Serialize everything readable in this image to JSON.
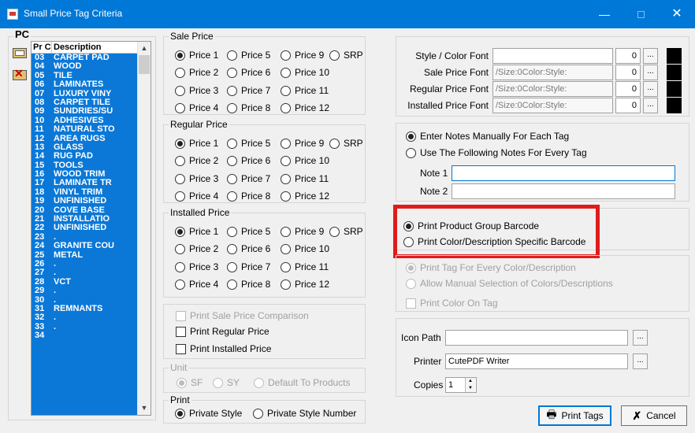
{
  "window": {
    "title": "Small Price Tag Criteria",
    "minimize": "—",
    "maximize": "",
    "close": "✕"
  },
  "pc_panel": {
    "label": "PC",
    "columns": [
      "Pr C",
      "Description"
    ],
    "rows": [
      {
        "pc": "03",
        "desc": "CARPET PAD"
      },
      {
        "pc": "04",
        "desc": "WOOD"
      },
      {
        "pc": "05",
        "desc": "TILE"
      },
      {
        "pc": "06",
        "desc": "LAMINATES"
      },
      {
        "pc": "07",
        "desc": "LUXURY VINY"
      },
      {
        "pc": "08",
        "desc": "CARPET TILE"
      },
      {
        "pc": "09",
        "desc": "SUNDRIES/SU"
      },
      {
        "pc": "10",
        "desc": "ADHESIVES"
      },
      {
        "pc": "11",
        "desc": "NATURAL STO"
      },
      {
        "pc": "12",
        "desc": "AREA RUGS"
      },
      {
        "pc": "13",
        "desc": "GLASS"
      },
      {
        "pc": "14",
        "desc": "RUG PAD"
      },
      {
        "pc": "15",
        "desc": "TOOLS"
      },
      {
        "pc": "16",
        "desc": "WOOD TRIM"
      },
      {
        "pc": "17",
        "desc": "LAMINATE TR"
      },
      {
        "pc": "18",
        "desc": "VINYL TRIM"
      },
      {
        "pc": "19",
        "desc": "UNFINISHED"
      },
      {
        "pc": "20",
        "desc": "COVE BASE"
      },
      {
        "pc": "21",
        "desc": "INSTALLATIO"
      },
      {
        "pc": "22",
        "desc": "UNFINISHED"
      },
      {
        "pc": "23",
        "desc": "."
      },
      {
        "pc": "24",
        "desc": "GRANITE COU"
      },
      {
        "pc": "25",
        "desc": "METAL"
      },
      {
        "pc": "26",
        "desc": "."
      },
      {
        "pc": "27",
        "desc": "."
      },
      {
        "pc": "28",
        "desc": "VCT"
      },
      {
        "pc": "29",
        "desc": "."
      },
      {
        "pc": "30",
        "desc": "."
      },
      {
        "pc": "31",
        "desc": "REMNANTS"
      },
      {
        "pc": "32",
        "desc": "."
      },
      {
        "pc": "33",
        "desc": "."
      },
      {
        "pc": "34",
        "desc": ""
      }
    ]
  },
  "sale_price": {
    "label": "Sale Price",
    "options": [
      "Price 1",
      "Price 5",
      "Price 9",
      "SRP",
      "Price 2",
      "Price 6",
      "Price 10",
      "Price 3",
      "Price 7",
      "Price 11",
      "Price 4",
      "Price 8",
      "Price 12"
    ],
    "selected": "Price 1"
  },
  "regular_price": {
    "label": "Regular Price",
    "options": [
      "Price 1",
      "Price 5",
      "Price 9",
      "SRP",
      "Price 2",
      "Price 6",
      "Price 10",
      "Price 3",
      "Price 7",
      "Price 11",
      "Price 4",
      "Price 8",
      "Price 12"
    ],
    "selected": "Price 1"
  },
  "installed_price": {
    "label": "Installed Price",
    "options": [
      "Price 1",
      "Price 5",
      "Price 9",
      "SRP",
      "Price 2",
      "Price 6",
      "Price 10",
      "Price 3",
      "Price 7",
      "Price 11",
      "Price 4",
      "Price 8",
      "Price 12"
    ],
    "selected": "Price 1"
  },
  "print_options": {
    "sale_comparison": "Print Sale Price Comparison",
    "regular": "Print Regular Price",
    "installed": "Print Installed Price"
  },
  "unit": {
    "label": "Unit",
    "sf": "SF",
    "sy": "SY",
    "default": "Default To Products",
    "selected": "SF"
  },
  "print_group": {
    "label": "Print",
    "private_style": "Private Style",
    "private_style_number": "Private Style Number",
    "selected": "Private Style"
  },
  "fonts": {
    "style_color": {
      "label": "Style / Color Font",
      "value": "",
      "size": "0"
    },
    "sale_price": {
      "label": "Sale Price Font",
      "value": "/Size:0Color:Style:",
      "size": "0"
    },
    "regular_price": {
      "label": "Regular Price Font",
      "value": "/Size:0Color:Style:",
      "size": "0"
    },
    "installed_price": {
      "label": "Installed Price Font",
      "value": "/Size:0Color:Style:",
      "size": "0"
    },
    "browse": "..."
  },
  "notes": {
    "manual": "Enter Notes Manually For Each Tag",
    "following": "Use The Following Notes For Every Tag",
    "selected": "manual",
    "note1_label": "Note 1",
    "note1_value": "",
    "note2_label": "Note 2",
    "note2_value": ""
  },
  "barcode": {
    "product_group": "Print Product Group Barcode",
    "color_desc": "Print Color/Description Specific Barcode",
    "selected": "product_group"
  },
  "tag_options": {
    "every_color": "Print Tag For Every Color/Description",
    "manual_selection": "Allow Manual Selection of Colors/Descriptions",
    "print_color": "Print Color On Tag"
  },
  "output": {
    "icon_path_label": "Icon Path",
    "icon_path_value": "",
    "printer_label": "Printer",
    "printer_value": "CutePDF Writer",
    "copies_label": "Copies",
    "copies_value": "1"
  },
  "buttons": {
    "print_tags": "Print Tags",
    "cancel": "Cancel"
  },
  "colors": {
    "accent": "#0078d7",
    "highlight": "#e01b1b",
    "list_bg": "#0b78d7"
  }
}
